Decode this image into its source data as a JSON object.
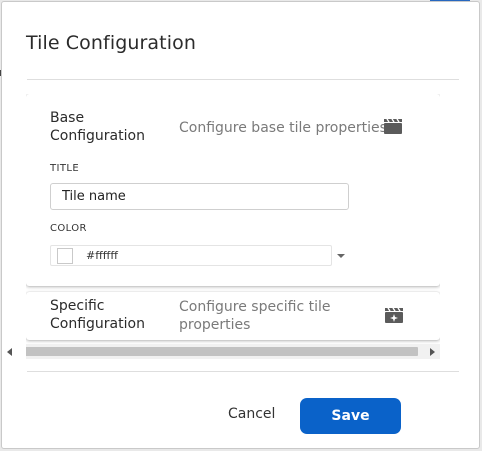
{
  "dialog": {
    "title": "Tile Configuration",
    "cancel_label": "Cancel",
    "save_label": "Save",
    "accent": "#0a62c9"
  },
  "base": {
    "title_line1": "Base",
    "title_line2": "Configuration",
    "description": "Configure base tile properties",
    "icon": "clapperboard-icon",
    "title_label": "TITLE",
    "title_value": "Tile name",
    "color_label": "COLOR",
    "color_value": "#ffffff"
  },
  "specific": {
    "title_line1": "Specific",
    "title_line2": "Configuration",
    "description_line1": "Configure specific tile",
    "description_line2": "properties",
    "icon": "clapperboard-sparkle-icon"
  }
}
